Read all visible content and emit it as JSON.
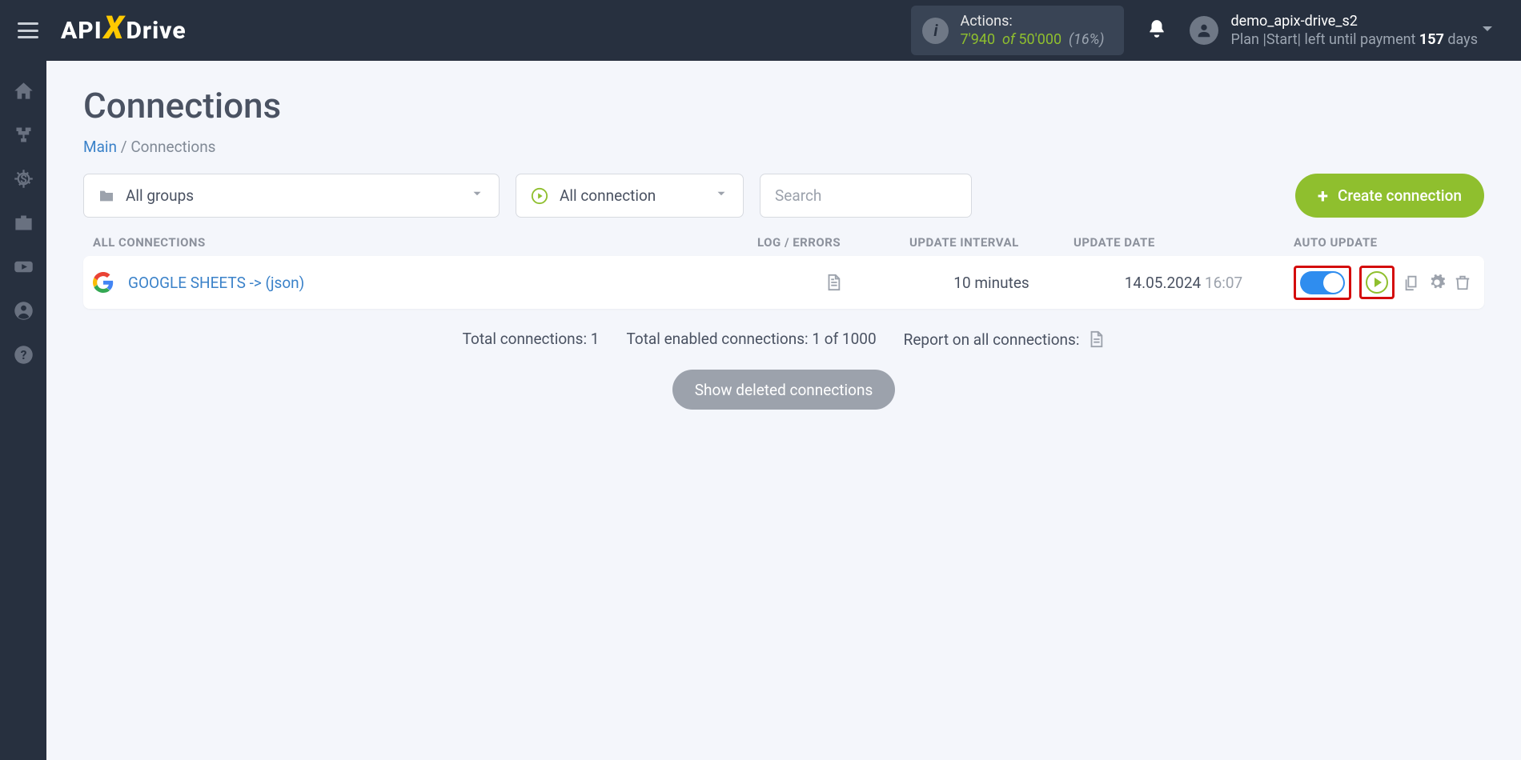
{
  "header": {
    "actions_label": "Actions:",
    "actions_used": "7'940",
    "actions_of": "of",
    "actions_limit": "50'000",
    "actions_pct": "(16%)",
    "user_name": "demo_apix-drive_s2",
    "plan_prefix": "Plan |",
    "plan_name": "Start",
    "plan_mid": "| left until payment ",
    "plan_days": "157",
    "plan_suffix": " days"
  },
  "page": {
    "title": "Connections",
    "bc_main": "Main",
    "bc_sep": " / ",
    "bc_current": "Connections"
  },
  "filters": {
    "groups": "All groups",
    "status": "All connection",
    "search_ph": "Search",
    "create": "Create connection"
  },
  "columns": {
    "name": "ALL CONNECTIONS",
    "log": "LOG / ERRORS",
    "interval": "UPDATE INTERVAL",
    "date": "UPDATE DATE",
    "auto": "AUTO UPDATE"
  },
  "row": {
    "name": "GOOGLE SHEETS -> (json)",
    "interval": "10 minutes",
    "date": "14.05.2024",
    "time": "16:07"
  },
  "summary": {
    "total": "Total connections: 1",
    "enabled": "Total enabled connections: 1 of 1000",
    "report": "Report on all connections:"
  },
  "show_deleted": "Show deleted connections"
}
